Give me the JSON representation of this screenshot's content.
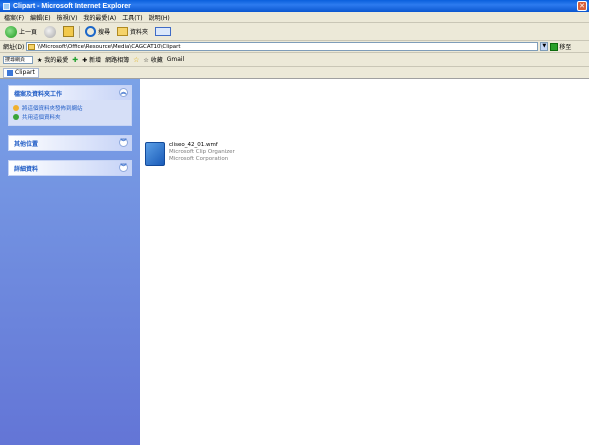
{
  "window": {
    "title": "Clipart - Microsoft Internet Explorer",
    "close_glyph": "✕",
    "app_icon": "explorer-icon"
  },
  "menu": {
    "items": [
      "檔案(F)",
      "編輯(E)",
      "檢視(V)",
      "我的最愛(A)",
      "工具(T)",
      "說明(H)"
    ]
  },
  "toolbar": {
    "back_label": "上一頁",
    "search_label": "搜尋",
    "folders_label": "資料夾"
  },
  "address": {
    "label": "網址(D)",
    "path": "\\\\Microsoft\\Office\\Resource\\Media\\CAGCAT10\\Clipart",
    "go_label": "移至",
    "dropdown_glyph": "▼"
  },
  "links_bar": {
    "search_placeholder": "搜尋網頁",
    "items": [
      "★ 我的最愛",
      "✚ 新增",
      "網路相簿",
      "☆ 收藏",
      "Gmail"
    ]
  },
  "nav_bar": {
    "location": "Clipart"
  },
  "left_pane": {
    "panels": [
      {
        "title": "檔案及資料夾工作",
        "collapse_glyph": "︽",
        "links": [
          {
            "text": "將這個資料夾發佈到網站",
            "icon": "publish-icon"
          },
          {
            "text": "共用這個資料夾",
            "icon": "share-icon"
          }
        ]
      },
      {
        "title": "其他位置",
        "collapse_glyph": "︾",
        "links": []
      },
      {
        "title": "詳細資料",
        "collapse_glyph": "︾",
        "links": []
      }
    ]
  },
  "content": {
    "files": [
      {
        "name": "cliseo_42_01.wmf",
        "description": "Microsoft Clip Organizer",
        "company": "Microsoft Corporation",
        "icon": "file-icon"
      }
    ],
    "scroll_glyph": "▴"
  }
}
